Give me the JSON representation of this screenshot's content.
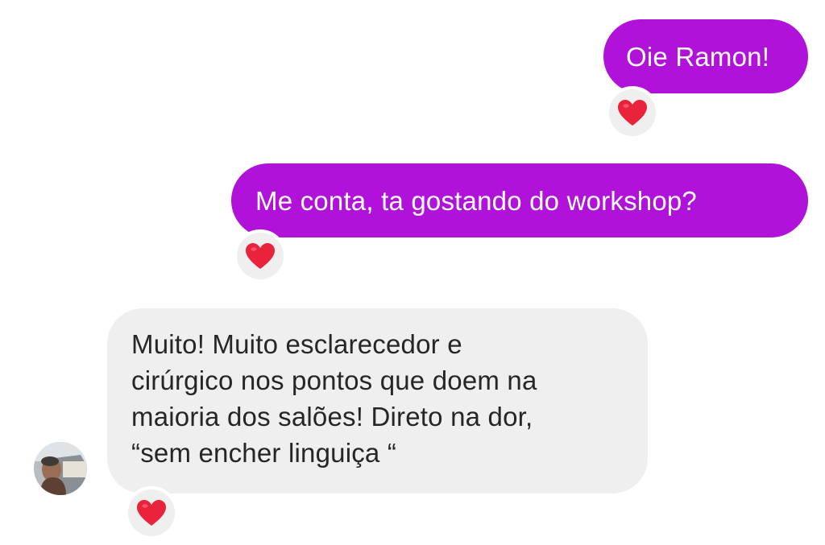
{
  "messages": [
    {
      "direction": "sent",
      "text": "Oie Ramon!",
      "reaction": "heart-icon"
    },
    {
      "direction": "sent",
      "text": "Me conta, ta gostando do workshop?",
      "reaction": "heart-icon"
    },
    {
      "direction": "received",
      "lines": [
        "Muito! Muito esclarecedor e",
        "cirúrgico nos pontos que doem na",
        "maioria dos salões! Direto na dor,",
        "“sem encher linguiça “"
      ],
      "reaction": "heart-icon"
    }
  ],
  "colors": {
    "sent_bubble": "#b012d9",
    "sent_text": "#ffffff",
    "received_bubble": "#efefef",
    "received_text": "#262626",
    "heart": "#e8233b"
  }
}
